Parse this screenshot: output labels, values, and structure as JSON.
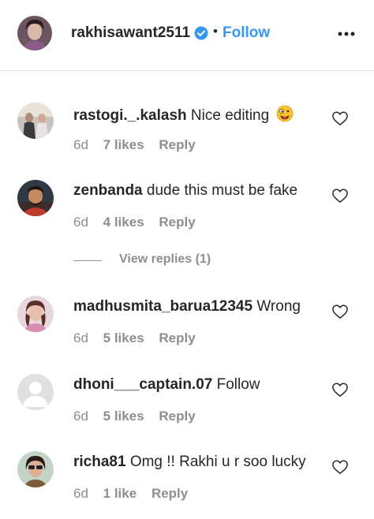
{
  "header": {
    "username": "rakhisawant2511",
    "separator": "•",
    "follow_label": "Follow",
    "verified_icon": "verified-badge-icon",
    "more_icon": "more-options-icon",
    "accent_color": "#3897f0"
  },
  "comments": [
    {
      "username": "rastogi._.kalash",
      "text": "Nice editing",
      "emoji": "crazy-face-emoji",
      "age": "6d",
      "likes": "7 likes",
      "reply": "Reply"
    },
    {
      "username": "zenbanda",
      "text": "dude this must be fake",
      "age": "6d",
      "likes": "4 likes",
      "reply": "Reply"
    },
    {
      "username": "madhusmita_barua12345",
      "text": "Wrong",
      "age": "6d",
      "likes": "5 likes",
      "reply": "Reply"
    },
    {
      "username": "dhoni___captain.07",
      "text": "Follow",
      "age": "6d",
      "likes": "5 likes",
      "reply": "Reply"
    },
    {
      "username": "richa81",
      "text": "Omg !! Rakhi u r soo lucky",
      "age": "6d",
      "likes": "1 like",
      "reply": "Reply"
    }
  ],
  "view_replies": "View replies (1)",
  "colors": {
    "text": "#262626",
    "muted": "#8e8e8e",
    "divider": "#e6e6e6"
  }
}
